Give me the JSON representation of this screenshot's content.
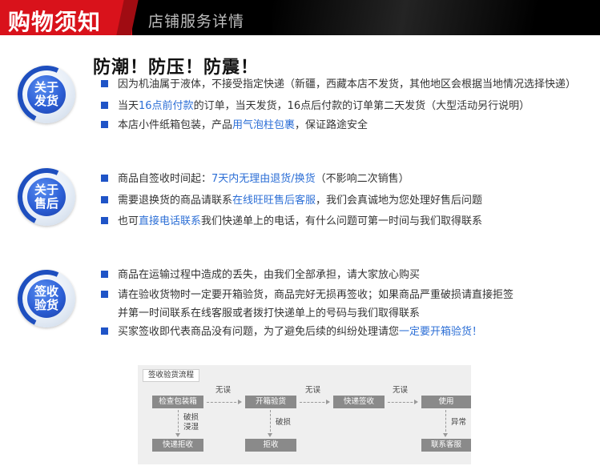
{
  "header": {
    "title": "购物须知",
    "subtitle": "店铺服务详情"
  },
  "shipping": {
    "badge": [
      "关于",
      "发货"
    ],
    "headline": "防潮！防压！防震！",
    "lines": [
      {
        "parts": [
          "因为机油属于液体，不接受指定快递（新疆，西藏本店不发货，其他地区会根据当地情况选择快递）"
        ]
      },
      {
        "pre": "当天",
        "hl": "16点前付款",
        "post": "的订单，当天发货，16点后付款的订单第二天发货（大型活动另行说明）"
      },
      {
        "pre": "本店小件纸箱包装，产品",
        "hl": "用气泡柱包裹",
        "post": "，保证路途安全"
      }
    ]
  },
  "after_sales": {
    "badge": [
      "关于",
      "售后"
    ],
    "lines": [
      {
        "pre": "商品自签收时间起：",
        "hl": "7天内无理由退货/换货",
        "post": "（不影响二次销售）"
      },
      {
        "pre": "需要退换货的商品请联系",
        "hl": "在线旺旺售后客服",
        "post": "，我们会真诚地为您处理好售后问题"
      },
      {
        "pre": "也可",
        "hl": "直接电话联系",
        "post": "我们快递单上的电话，有什么问题可第一时间与我们取得联系"
      }
    ]
  },
  "inspection": {
    "badge": [
      "签收",
      "验货"
    ],
    "lines": [
      {
        "pre": "商品在运输过程中造成的丢失，由我们全部承担，请大家放心购买",
        "hl": "",
        "post": ""
      },
      {
        "pre": "请在验收货物时一定要开箱验货，商品完好无损再签收；如果商品严重破损请直接拒签",
        "hl": "",
        "post": ""
      },
      {
        "pre": "并第一时间联系在线客服或者拨打快递单上的号码与我们取得联系",
        "hl": "",
        "post": ""
      },
      {
        "pre": "买家签收即代表商品没有问题，为了避免后续的纠纷处理请您",
        "hl": "一定要开箱验货！",
        "post": ""
      }
    ]
  },
  "flow": {
    "tag": "签收验货流程",
    "boxes": {
      "check": "检查包装箱",
      "open": "开箱验货",
      "sign": "快递签收",
      "use": "使用",
      "reject_courier": "快递拒收",
      "reject": "拒收",
      "service": "联系客服"
    },
    "labels": {
      "ok1": "无误",
      "ok2": "无误",
      "ok3": "无误",
      "damaged_wet": "破损\n浸湿",
      "damaged": "破损",
      "abnormal": "异常"
    }
  },
  "colors": {
    "header_red": "#d9121b",
    "accent_blue": "#1f54c7",
    "highlight": "#2d6fd6"
  }
}
